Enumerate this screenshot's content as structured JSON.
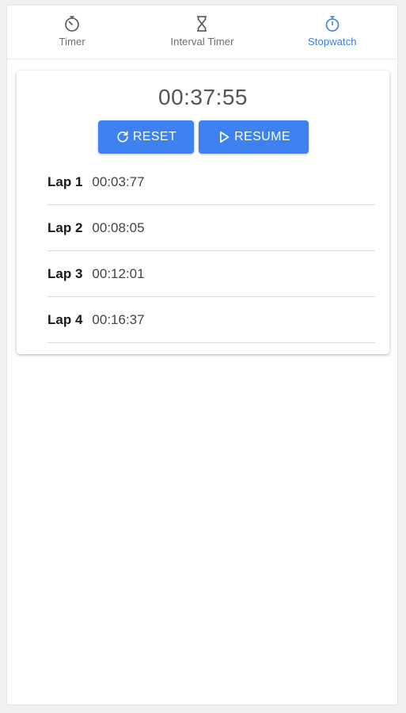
{
  "tabs": [
    {
      "label": "Timer",
      "icon": "timer-icon"
    },
    {
      "label": "Interval Timer",
      "icon": "hourglass-icon"
    },
    {
      "label": "Stopwatch",
      "icon": "stopwatch-icon",
      "active": true
    }
  ],
  "stopwatch": {
    "elapsed": "00:37:55",
    "reset_label": "RESET",
    "resume_label": "RESUME"
  },
  "laps": [
    {
      "name": "Lap 1",
      "time": "00:03:77"
    },
    {
      "name": "Lap 2",
      "time": "00:08:05"
    },
    {
      "name": "Lap 3",
      "time": "00:12:01"
    },
    {
      "name": "Lap 4",
      "time": "00:16:37"
    }
  ],
  "colors": {
    "accent": "#3d82f0",
    "active_tab": "#3a7fe0",
    "inactive_tab": "#6e6e6e"
  }
}
